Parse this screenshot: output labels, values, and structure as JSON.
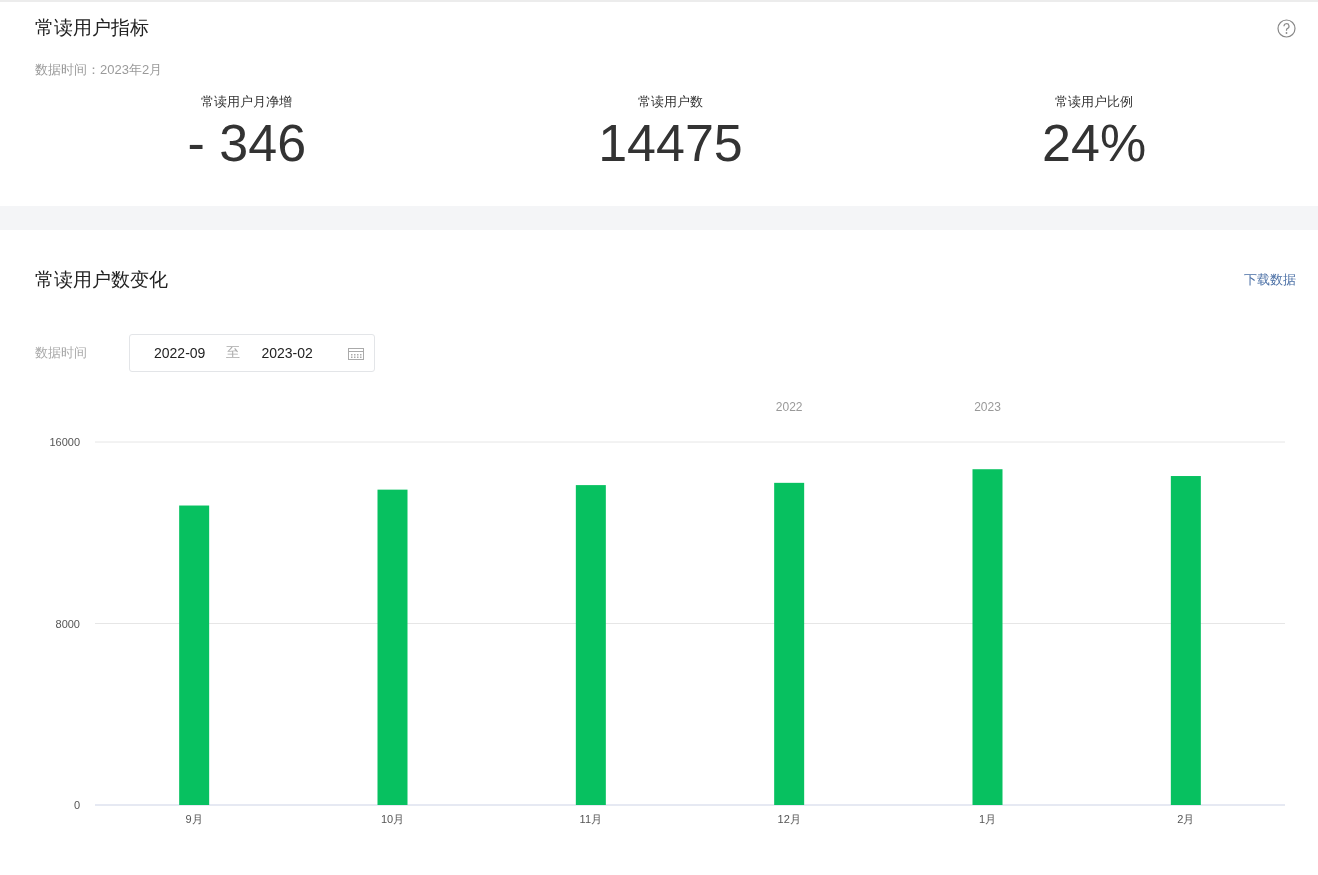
{
  "metrics_card": {
    "title": "常读用户指标",
    "data_time": "数据时间：2023年2月",
    "metrics": [
      {
        "label": "常读用户月净增",
        "value": "- 346"
      },
      {
        "label": "常读用户数",
        "value": "14475"
      },
      {
        "label": "常读用户比例",
        "value": "24%"
      }
    ]
  },
  "trend_card": {
    "title": "常读用户数变化",
    "download_link": "下载数据",
    "range_label": "数据时间",
    "range_start": "2022-09",
    "range_separator": "至",
    "range_end": "2023-02",
    "chart_data": {
      "type": "bar",
      "categories": [
        "9月",
        "10月",
        "11月",
        "12月",
        "1月",
        "2月"
      ],
      "series": [
        {
          "color": "#07c160",
          "values": [
            13200,
            13900,
            14100,
            14200,
            14800,
            14500
          ]
        }
      ],
      "ylim": [
        0,
        16000
      ],
      "yticks": [
        0,
        8000,
        16000
      ],
      "annotations": [
        "2022",
        "2023"
      ]
    }
  }
}
